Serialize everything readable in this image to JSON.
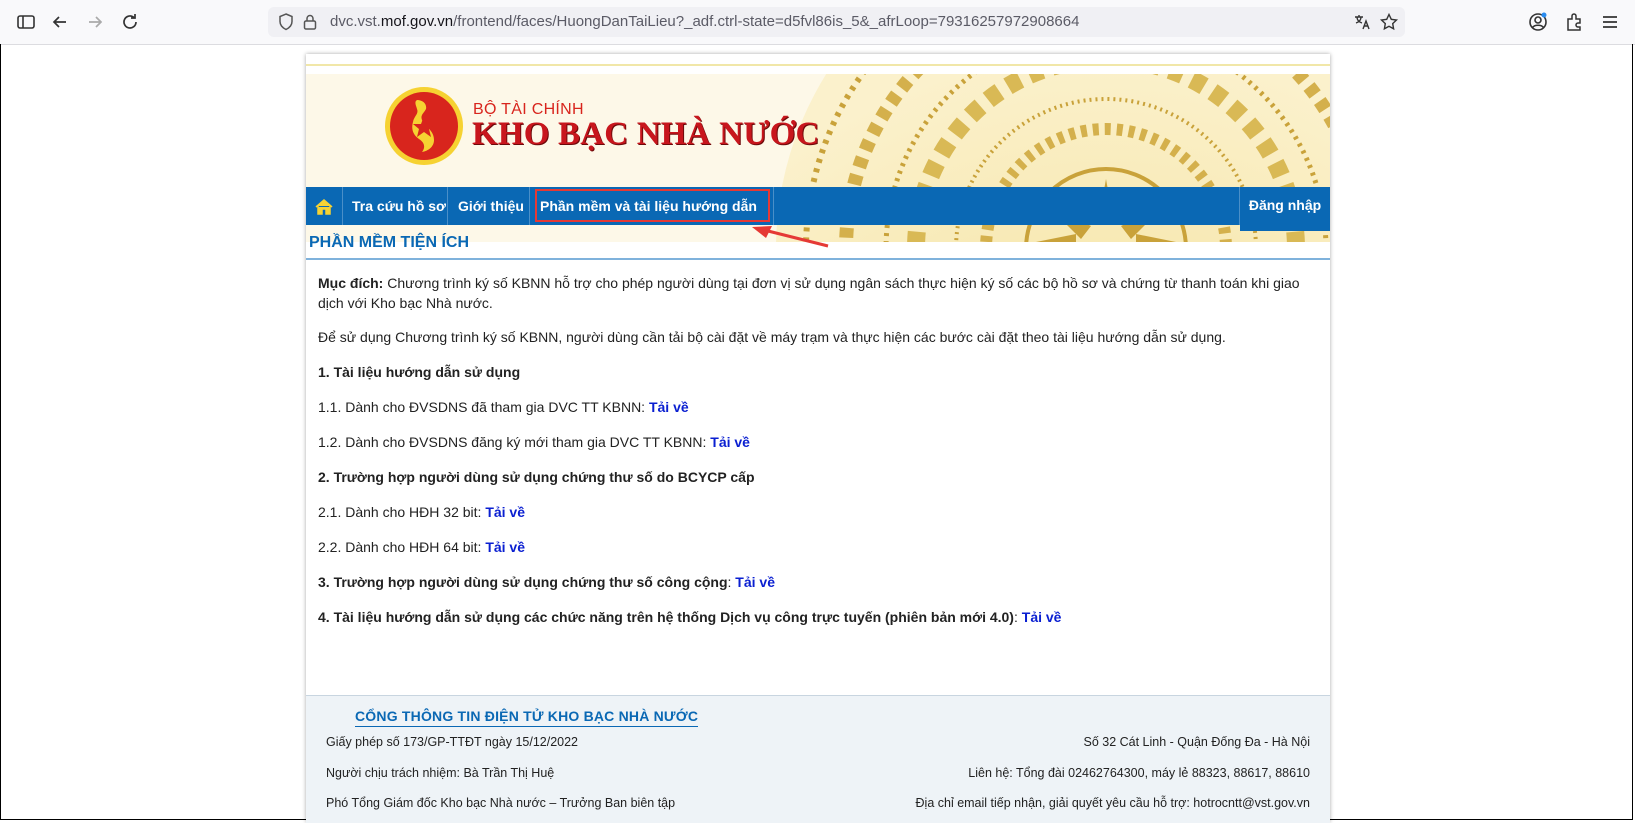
{
  "browser": {
    "url_prefix": "dvc.vst.",
    "url_domain": "mof.gov.vn",
    "url_path": "/frontend/faces/HuongDanTaiLieu?_adf.ctrl-state=d5fvl86is_5&_afrLoop=79316257972908664"
  },
  "header": {
    "ministry": "BỘ TÀI CHÍNH",
    "agency": "KHO BẠC NHÀ NƯỚC"
  },
  "nav": {
    "items": [
      "Tra cứu hồ sơ",
      "Giới thiệu",
      "Phần mềm và tài liệu hướng dẫn"
    ],
    "login": "Đăng nhập"
  },
  "content": {
    "title": "PHẦN MỀM TIỆN ÍCH",
    "purpose_label": "Mục đích:",
    "purpose_text": " Chương trình ký số KBNN hỗ trợ cho phép người dùng tại đơn vị sử dụng ngân sách thực hiện ký số các bộ hồ sơ và chứng từ thanh toán khi giao dịch với Kho bạc Nhà nước.",
    "intro": "Để sử dụng Chương trình ký số KBNN, người dùng cần tải bộ cài đặt về máy trạm và thực hiện các bước cài đặt theo tài liệu hướng dẫn sử dụng.",
    "s1": "1. Tài liệu hướng dẫn sử dụng",
    "s1_1": "1.1. Dành cho ĐVSDNS đã tham gia DVC TT KBNN: ",
    "s1_2": "1.2. Dành cho ĐVSDNS đăng ký mới tham gia DVC TT KBNN: ",
    "s2": "2. Trường hợp người dùng sử dụng chứng thư số do BCYCP cấp",
    "s2_1": "2.1. Dành cho HĐH 32 bit: ",
    "s2_2": "2.2. Dành cho HĐH 64 bit: ",
    "s3": "3. Trường hợp người dùng sử dụng chứng thư số công cộng",
    "s4": "4. Tài liệu hướng dẫn sử dụng các chức năng trên hệ thống Dịch vụ công trực tuyến (phiên bản mới 4.0)",
    "colon": ": ",
    "download": "Tải về"
  },
  "footer": {
    "title": "CỔNG THÔNG TIN ĐIỆN TỬ KHO BẠC NHÀ NƯỚC",
    "license": "Giấy phép số 173/GP-TTĐT ngày 15/12/2022",
    "responsible": "Người chịu trách nhiệm: Bà Trần Thị Huệ",
    "editor": "Phó Tổng Giám đốc Kho bạc Nhà nước – Trưởng Ban biên tập",
    "address": "Số 32 Cát Linh - Quận Đống Đa - Hà Nội",
    "contact": "Liên hệ: Tổng đài 02462764300, máy lẻ 88323, 88617, 88610",
    "email": "Địa chỉ email tiếp nhận, giải quyết yêu cầu hỗ trợ: hotrocntt@vst.gov.vn"
  },
  "colors": {
    "nav_blue": "#0a68b4",
    "brand_red": "#c8161d",
    "link_blue": "#0a1fd1",
    "highlight_red": "#e53935"
  }
}
